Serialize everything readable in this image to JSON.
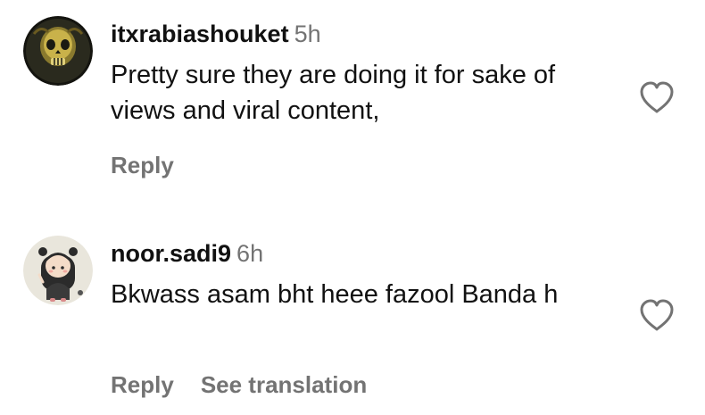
{
  "comments": [
    {
      "username": "itxrabiashouket",
      "time": "5h",
      "text": "Pretty sure they are doing it for sake of views and viral content,",
      "actions": [
        "Reply"
      ],
      "avatar_icon": "skull-avatar"
    },
    {
      "username": "noor.sadi9",
      "time": "6h",
      "text": "Bkwass asam bht heee fazool Banda h",
      "actions": [
        "Reply",
        "See translation"
      ],
      "avatar_icon": "anime-girl-avatar"
    }
  ],
  "colors": {
    "text": "#111111",
    "muted": "#737373",
    "like_outline": "#737373"
  }
}
